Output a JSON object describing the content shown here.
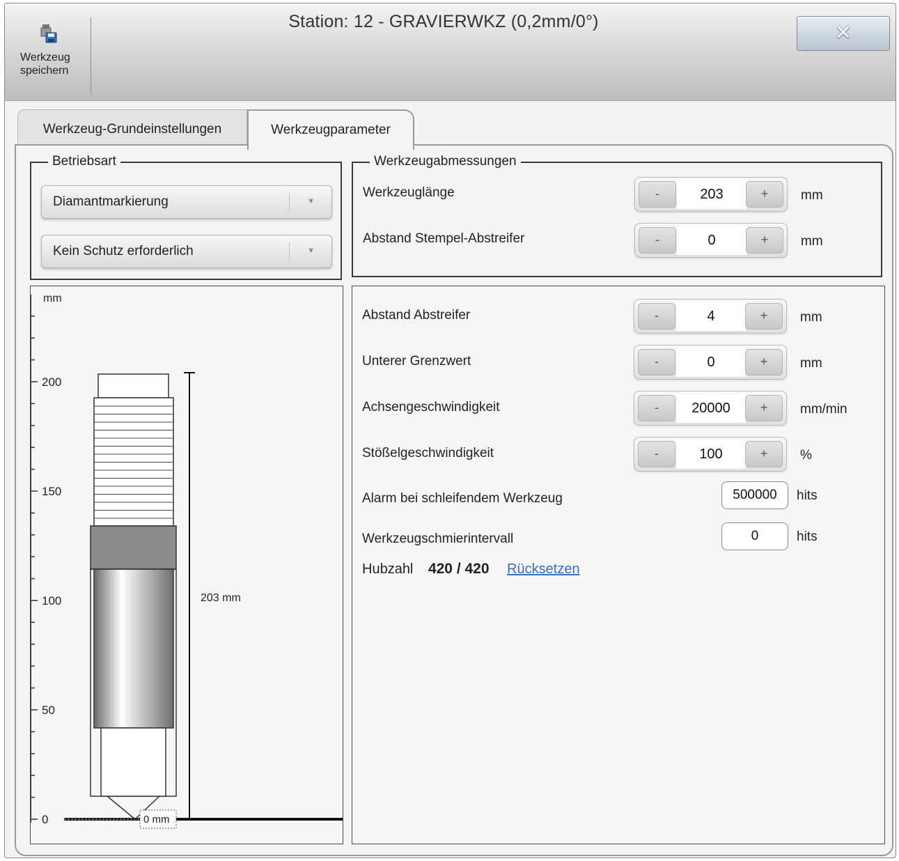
{
  "window": {
    "title": "Station: 12 - GRAVIERWKZ (0,2mm/0°)",
    "close_label": "✕"
  },
  "toolbar": {
    "save_tool_label_line1": "Werkzeug",
    "save_tool_label_line2": "speichern",
    "save_tool_icon": "save-disk-icon"
  },
  "tabs": [
    {
      "label": "Werkzeug-Grundeinstellungen",
      "active": false
    },
    {
      "label": "Werkzeugparameter",
      "active": true
    }
  ],
  "betriebsart": {
    "title": "Betriebsart",
    "mode_selected": "Diamantmarkierung",
    "protection_selected": "Kein Schutz erforderlich"
  },
  "abmessungen": {
    "title": "Werkzeugabmessungen",
    "rows": [
      {
        "label": "Werkzeuglänge",
        "value": "203",
        "unit": "mm"
      },
      {
        "label": "Abstand Stempel-Abstreifer",
        "value": "0",
        "unit": "mm"
      }
    ]
  },
  "params": {
    "steppers": [
      {
        "label": "Abstand Abstreifer",
        "value": "4",
        "unit": "mm"
      },
      {
        "label": "Unterer Grenzwert",
        "value": "0",
        "unit": "mm"
      },
      {
        "label": "Achsengeschwindigkeit",
        "value": "20000",
        "unit": "mm/min"
      },
      {
        "label": "Stößelgeschwindigkeit",
        "value": "100",
        "unit": "%"
      }
    ],
    "inputs": [
      {
        "label": "Alarm bei schleifendem Werkzeug",
        "value": "500000",
        "unit": "hits"
      },
      {
        "label": "Werkzeugschmierintervall",
        "value": "0",
        "unit": "hits"
      }
    ],
    "stroke_label": "Hubzahl",
    "stroke_count": "420 / 420",
    "reset_link": "Rücksetzen"
  },
  "diagram": {
    "unit_label": "mm",
    "ticks": [
      "200",
      "150",
      "100",
      "50",
      "0"
    ],
    "length_label": "203 mm",
    "tip_label": "0 mm",
    "tool_length_mm": 203,
    "axis_max_mm": 200
  },
  "colors": {
    "link": "#3a6fb7",
    "collar": "#8c8c8c",
    "border_dark": "#3a3a3a"
  }
}
